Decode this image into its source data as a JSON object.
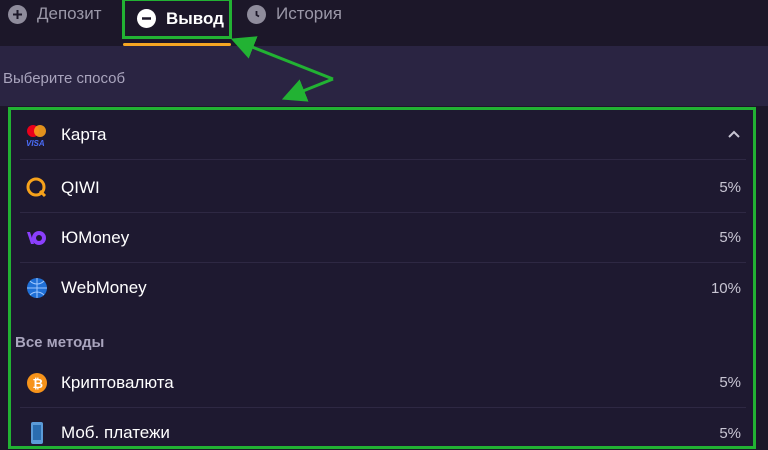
{
  "tabs": [
    {
      "label": "Депозит"
    },
    {
      "label": "Вывод"
    },
    {
      "label": "История"
    }
  ],
  "subheader": {
    "label": "Выберите способ"
  },
  "methods": [
    {
      "name": "Карта",
      "fee": ""
    },
    {
      "name": "QIWI",
      "fee": "5%"
    },
    {
      "name": "ЮMoney",
      "fee": "5%"
    },
    {
      "name": "WebMoney",
      "fee": "10%"
    }
  ],
  "all_methods": {
    "title": "Все методы",
    "items": [
      {
        "name": "Криптовалюта",
        "fee": "5%"
      },
      {
        "name": "Моб. платежи",
        "fee": "5%"
      }
    ]
  },
  "colors": {
    "highlight": "#22b233",
    "accent": "#f5a623"
  }
}
